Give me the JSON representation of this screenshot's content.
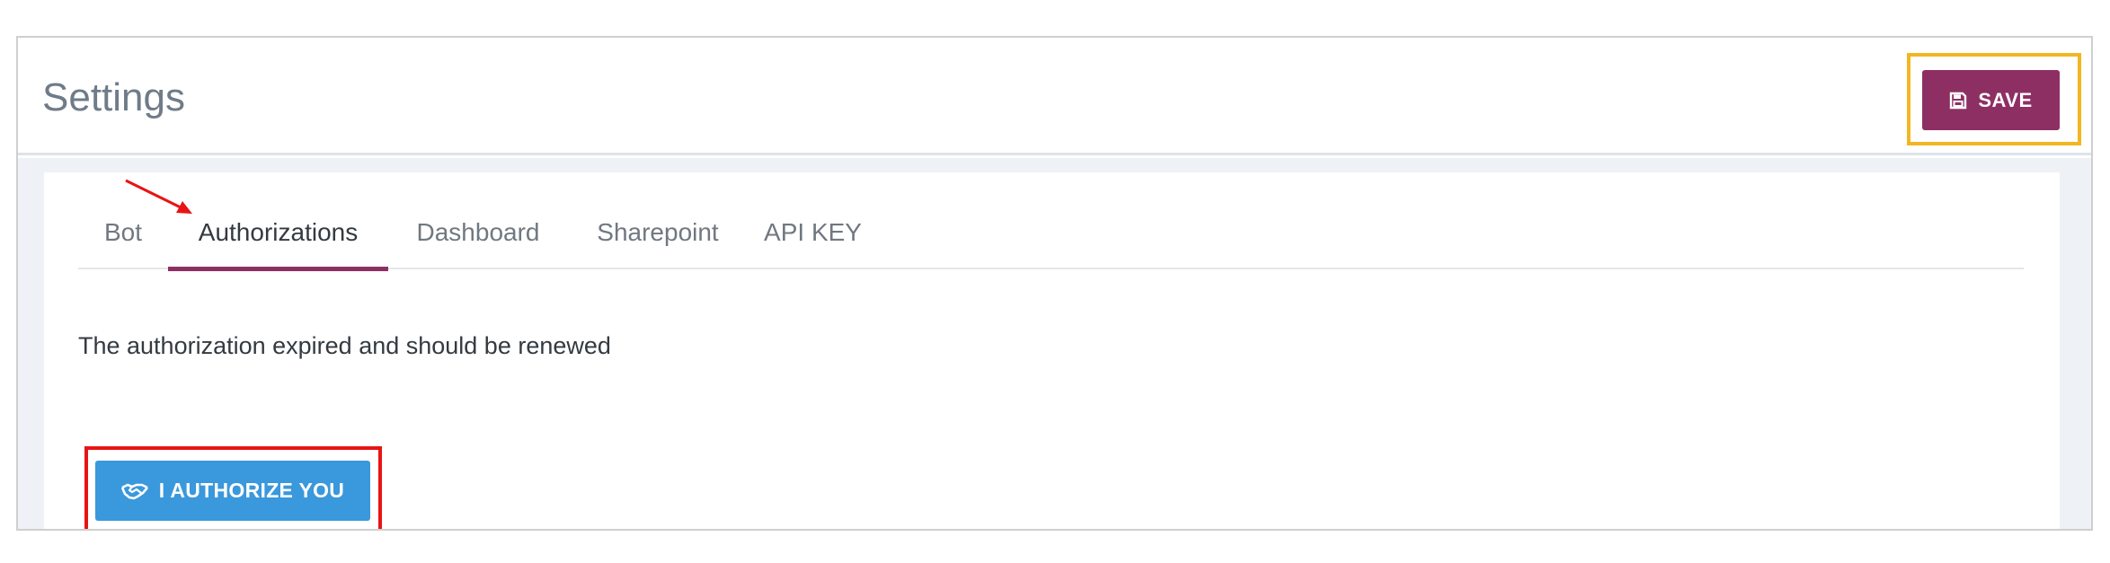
{
  "header": {
    "title": "Settings",
    "save_label": "SAVE"
  },
  "tabs": [
    {
      "label": "Bot",
      "active": false
    },
    {
      "label": "Authorizations",
      "active": true
    },
    {
      "label": "Dashboard",
      "active": false
    },
    {
      "label": "Sharepoint",
      "active": false
    },
    {
      "label": "API KEY",
      "active": false
    }
  ],
  "authorization": {
    "message": "The authorization expired and should be renewed",
    "button_label": "I AUTHORIZE YOU"
  },
  "colors": {
    "accent": "#8e2f64",
    "primary_button": "#3a98dc",
    "save_highlight": "#f2b622",
    "auth_highlight": "#e81414",
    "arrow": "#e81414"
  },
  "icons": {
    "save": "floppy-disk-icon",
    "authorize": "handshake-icon"
  }
}
